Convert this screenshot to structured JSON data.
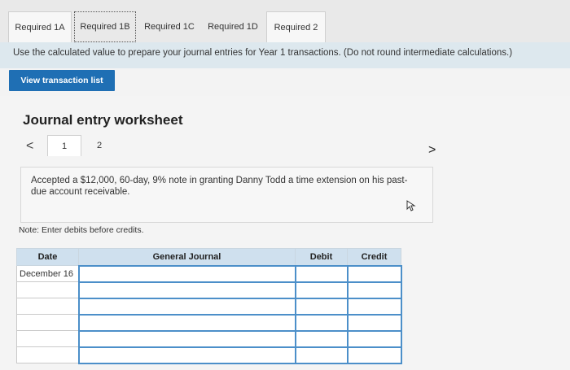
{
  "tabs": [
    {
      "label": "Required 1A"
    },
    {
      "label": "Required 1B"
    },
    {
      "label": "Required 1C"
    },
    {
      "label": "Required 1D"
    },
    {
      "label": "Required 2"
    }
  ],
  "instruction": "Use the calculated value to prepare your journal entries for Year 1 transactions. (Do not round intermediate calculations.)",
  "view_button": "View transaction list",
  "worksheet": {
    "title": "Journal entry worksheet",
    "prev": "<",
    "next": ">",
    "pages": [
      "1",
      "2"
    ],
    "description": "Accepted a $12,000, 60-day, 9% note in granting Danny Todd a time extension on his past-due account receivable.",
    "note": "Note: Enter debits before credits."
  },
  "journal": {
    "headers": {
      "date": "Date",
      "general": "General Journal",
      "debit": "Debit",
      "credit": "Credit"
    },
    "date_value": "December 16"
  }
}
